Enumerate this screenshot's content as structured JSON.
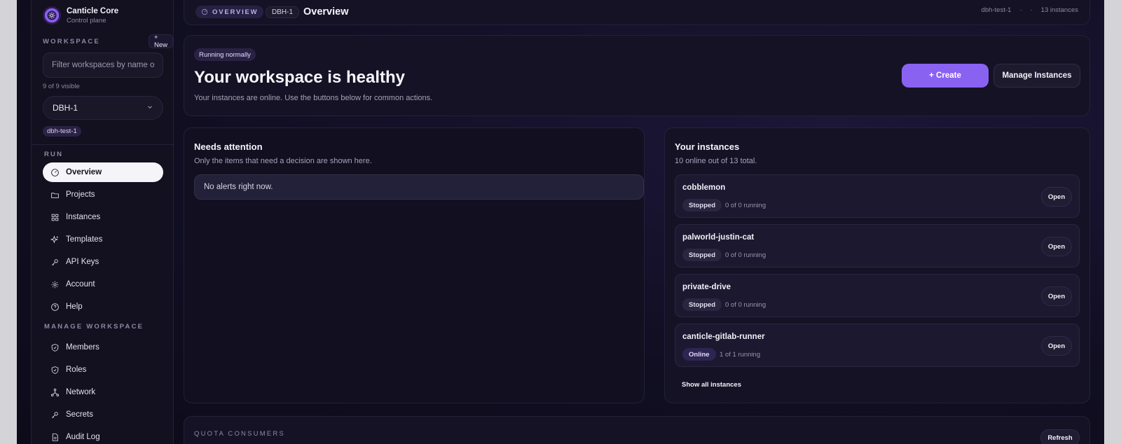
{
  "brand": {
    "name": "Canticle Core",
    "subtitle": "Control plane"
  },
  "sidebar": {
    "workspace_label": "WORKSPACE",
    "new_button": "+ New",
    "filter_placeholder": "Filter workspaces by name or",
    "visible_count": "9 of 9 visible",
    "selected_workspace": "DBH-1",
    "workspace_chip": "dbh-test-1",
    "run_label": "RUN",
    "run_items": [
      {
        "label": "Overview",
        "icon": "gauge-icon",
        "active": true
      },
      {
        "label": "Projects",
        "icon": "folder-icon"
      },
      {
        "label": "Instances",
        "icon": "grid-icon"
      },
      {
        "label": "Templates",
        "icon": "sparkles-icon"
      },
      {
        "label": "API Keys",
        "icon": "key-icon"
      },
      {
        "label": "Account",
        "icon": "gear-icon"
      },
      {
        "label": "Help",
        "icon": "help-circle-icon"
      }
    ],
    "manage_label": "MANAGE WORKSPACE",
    "manage_items": [
      {
        "label": "Members",
        "icon": "shield-icon"
      },
      {
        "label": "Roles",
        "icon": "shield-icon"
      },
      {
        "label": "Network",
        "icon": "network-icon"
      },
      {
        "label": "Secrets",
        "icon": "key-icon"
      },
      {
        "label": "Audit Log",
        "icon": "document-icon"
      }
    ]
  },
  "topbar": {
    "section_pill": "OVERVIEW",
    "crumb": "DBH-1",
    "title": "Overview",
    "meta_workspace": "dbh-test-1",
    "meta_sep1": "·",
    "meta_sep2": "·",
    "meta_instances": "13 instances"
  },
  "hero": {
    "status_chip": "Running normally",
    "title": "Your workspace is healthy",
    "description": "Your instances are online. Use the buttons below for common actions.",
    "create_button": "+ Create",
    "manage_button": "Manage Instances"
  },
  "attention": {
    "title": "Needs attention",
    "subtitle": "Only the items that need a decision are shown here.",
    "empty_message": "No alerts right now."
  },
  "instances": {
    "title": "Your instances",
    "subtitle": "10 online out of 13 total.",
    "open_label": "Open",
    "items": [
      {
        "name": "cobblemon",
        "status": "Stopped",
        "running": "0 of 0 running"
      },
      {
        "name": "palworld-justin-cat",
        "status": "Stopped",
        "running": "0 of 0 running"
      },
      {
        "name": "private-drive",
        "status": "Stopped",
        "running": "0 of 0 running"
      },
      {
        "name": "canticle-gitlab-runner",
        "status": "Online",
        "running": "1 of 1 running"
      }
    ],
    "show_all": "Show all instances"
  },
  "quota": {
    "label": "QUOTA CONSUMERS",
    "refresh_button": "Refresh"
  },
  "colors": {
    "accent": "#8a62f2",
    "background": "#110e22"
  }
}
